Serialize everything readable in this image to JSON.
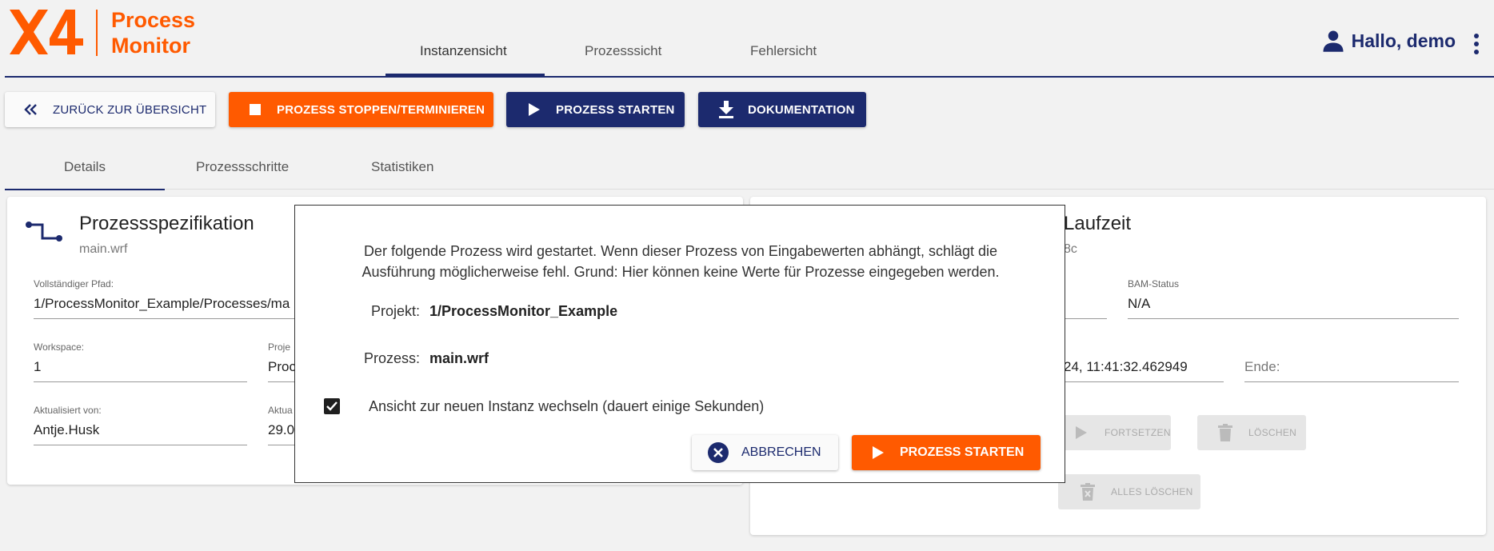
{
  "app": {
    "logo_line1": "Process",
    "logo_line2": "Monitor",
    "user_greeting": "Hallo, demo",
    "brand_orange": "#ff5a00",
    "brand_navy": "#1c2a6e"
  },
  "nav": {
    "tabs": [
      {
        "label": "Instanzensicht",
        "active": true
      },
      {
        "label": "Prozesssicht",
        "active": false
      },
      {
        "label": "Fehlersicht",
        "active": false
      }
    ]
  },
  "toolbar": {
    "back_label": "ZURÜCK ZUR ÜBERSICHT",
    "stop_label": "PROZESS STOPPEN/TERMINIEREN",
    "start_label": "PROZESS STARTEN",
    "docs_label": "DOKUMENTATION"
  },
  "subtabs": [
    {
      "label": "Details",
      "active": true
    },
    {
      "label": "Prozessschritte",
      "active": false
    },
    {
      "label": "Statistiken",
      "active": false
    }
  ],
  "spec_card": {
    "title": "Prozessspezifikation",
    "subtitle": "main.wrf",
    "fields": {
      "full_path": {
        "label": "Vollständiger Pfad:",
        "value": "1/ProcessMonitor_Example/Processes/ma"
      },
      "workspace": {
        "label": "Workspace:",
        "value": "1"
      },
      "project": {
        "label": "Proje",
        "value": "Proc"
      },
      "updated_by": {
        "label": "Aktualisiert von:",
        "value": "Antje.Husk"
      },
      "updated_at": {
        "label": "Aktua",
        "value": "29.0"
      }
    }
  },
  "runtime_card": {
    "title": "Laufzeit",
    "subtitle": "8c",
    "fields": {
      "bam_status": {
        "label": "BAM-Status",
        "value": "N/A"
      },
      "start": {
        "value": "24, 11:41:32.462949"
      },
      "end": {
        "label": "Ende:"
      }
    },
    "actions": {
      "continue_label": "FORTSETZEN",
      "delete_label": "LÖSCHEN",
      "delete_all_label": "ALLES LÖSCHEN"
    }
  },
  "dialog": {
    "message": "Der folgende Prozess wird gestartet. Wenn dieser Prozess von Eingabewerten abhängt, schlägt die Ausführung möglicherweise fehl. Grund: Hier können keine Werte für Prozesse eingegeben werden.",
    "project_label": "Projekt:",
    "project_value": "1/ProcessMonitor_Example",
    "process_label": "Prozess:",
    "process_value": "main.wrf",
    "checkbox_label": "Ansicht zur neuen Instanz wechseln (dauert einige Sekunden)",
    "checkbox_checked": true,
    "cancel_label": "ABBRECHEN",
    "start_label": "PROZESS STARTEN"
  }
}
